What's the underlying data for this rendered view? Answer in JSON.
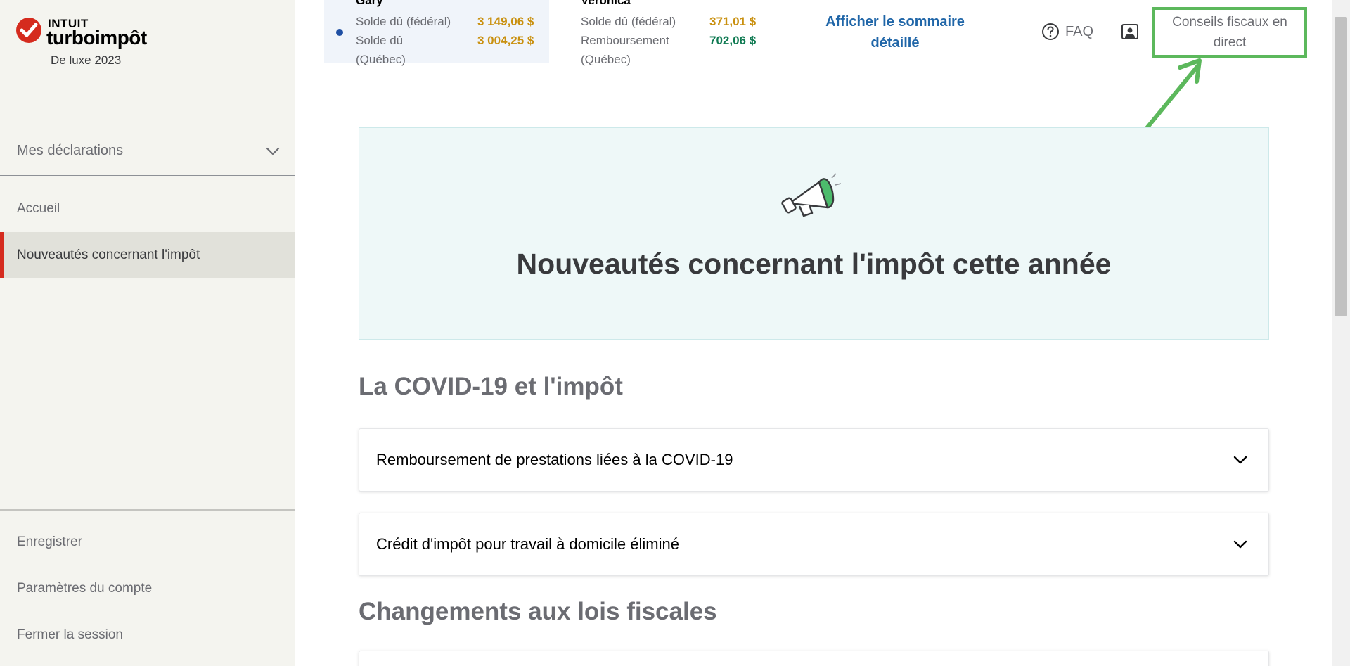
{
  "brand": {
    "company": "INTUIT",
    "product": "turboimpôt",
    "trademark": ".",
    "edition": "De luxe 2023"
  },
  "sidebar": {
    "returns_label": "Mes déclarations",
    "items": [
      {
        "label": "Accueil",
        "active": false
      },
      {
        "label": "Nouveautés concernant l'impôt",
        "active": true
      }
    ],
    "bottom_links": [
      {
        "label": "Enregistrer"
      },
      {
        "label": "Paramètres du compte"
      },
      {
        "label": "Fermer la session"
      }
    ]
  },
  "header": {
    "persons": [
      {
        "name": "Gary",
        "selected": true,
        "line1_label": "Solde dû (fédéral)",
        "line1_amount": "3  149,06  $",
        "line1_kind": "due",
        "line2_label": "Solde dû",
        "line2_label_cont": "(Québec)",
        "line2_amount": "3  004,25  $",
        "line2_kind": "due"
      },
      {
        "name": "Veronica",
        "selected": false,
        "line1_label": "Solde dû (fédéral)",
        "line1_amount": "371,01  $",
        "line1_kind": "due",
        "line2_label": "Remboursement",
        "line2_label_cont": "(Québec)",
        "line2_amount": "702,06  $",
        "line2_kind": "refund"
      }
    ],
    "summary_link": "Afficher le sommaire détaillé",
    "faq_label": "FAQ",
    "live_advice_label": "Conseils fiscaux en direct"
  },
  "main": {
    "banner_title": "Nouveautés concernant l'impôt cette année",
    "sections": [
      {
        "title": "La COVID-19 et l'impôt",
        "items": [
          "Remboursement de prestations liées à la COVID-19",
          "Crédit d'impôt pour travail à domicile éliminé"
        ]
      },
      {
        "title": "Changements aux lois fiscales",
        "items": []
      }
    ]
  },
  "colors": {
    "accent_red": "#d52b1e",
    "due_amount": "#c9900f",
    "refund_amount": "#0f7a52",
    "link_blue": "#2066a8",
    "annotation_green": "#5cb85c"
  }
}
